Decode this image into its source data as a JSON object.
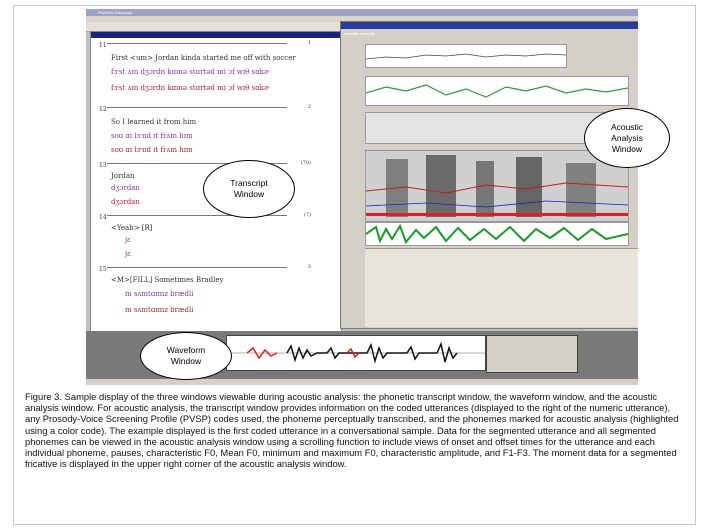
{
  "screenshot": {
    "main_title": "Phonetic Transcript",
    "acoustic_title": "Acoustic Analysis",
    "utterances": [
      {
        "num": "11",
        "words": "First  <um>  Jordan  kinda  started  me off with soccer",
        "ph": "fɝst  ʌm  dʒɔrdn  kɑɪnə  stɑrtəd  mi  ɔf  wɪθ  sɑkɚ",
        "code": "1"
      },
      {
        "num": "12",
        "words": "So  I  learned  it  from  him",
        "ph": "soʊ  ɑɪ  lɝnd  ɪt  frʌm  hɪm",
        "code": "2"
      },
      {
        "num": "13",
        "words": "Jordan",
        "ph": "dʒɔrdan",
        "code": "(78)"
      },
      {
        "num": "14",
        "words": "<Yeah> [R]",
        "ph": "jɛ",
        "code": "(7)"
      },
      {
        "num": "15",
        "words": "<M>[FILL]  Sometimes  Bradley",
        "ph": "m      sʌmtɑɪmz  brædli",
        "code": "3"
      }
    ]
  },
  "labels": {
    "transcript": "Transcript Window",
    "acoustic": "Acoustic Analysis Window",
    "waveform": "Waveform Window"
  },
  "caption": "Figure 3. Sample display of the three windows viewable during acoustic analysis: the phonetic transcript window, the waveform window, and the acoustic analysis window. For acoustic analysis, the transcript window provides information on the coded utterances (displayed to the right of the numeric utterance), any Prosody-Voice Screening Profile (PVSP) codes used, the phoneme perceptually transcribed, and the phonemes marked for acoustic analysis (highlighted using a color code). The example displayed is the first coded utterance in a conversational sample. Data for the segmented utterance and all segmented phonemes can be viewed in the acoustic analysis window using a scrolling function to include views of onset and offset times for the utterance and each individual phoneme, pauses, characteristic F0, Mean F0, minimum and maximum F0, characteristic amplitude, and F1-F3. The moment data for a segmented fricative is displayed in the upper right corner of the acoustic analysis window."
}
